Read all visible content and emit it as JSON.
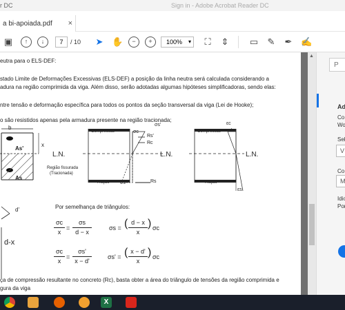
{
  "window": {
    "title_left": "r DC",
    "title_center": "Sign in - Adobe Acrobat Reader DC"
  },
  "tab": {
    "label": "a bi-apoiada.pdf"
  },
  "toolbar": {
    "page_current": "7",
    "page_total": "/ 10",
    "zoom": "100%"
  },
  "doc": {
    "line1": "eutra para o ELS-DEF:",
    "line2": "stado Limite de Deformações Excessivas (ELS-DEF) a posição da linha neutra será calculada considerando a",
    "line3": "adura na região comprimida da viga. Além disso, serão adotadas algumas hipóteses simplificadoras, sendo elas:",
    "line4": "ntre tensão e deformação específica para todos os pontos da seção transversal da viga (Lei de Hooke);",
    "line5": "o são resistidos apenas pela armadura presente na região tracionada;",
    "fig1": {
      "b": "b",
      "x": "x",
      "as_top": "As'",
      "as_bot": "As",
      "ln": "L.N.",
      "region": "Região fissurada",
      "region2": "(Tracionada)"
    },
    "fig2": {
      "comp": "Compressão",
      "trac": "Tração",
      "rs_prime": "Rs'",
      "rc": "Rc",
      "rs": "Rs",
      "ln": "L.N.",
      "sigma_s_prime": "σs'",
      "sigma_c": "σc",
      "sigma_s": "σs"
    },
    "fig3": {
      "comp": "Compressão",
      "trac": "Tração",
      "ln": "L.N.",
      "ec": "εc",
      "es_prime": "εs'",
      "es": "εs"
    },
    "tri_label": "Por semelhança de triângulos:",
    "dx": "d-x",
    "dprime": "d'",
    "eq1_left_num": "σc",
    "eq1_left_den": "x",
    "eq1_mid_num": "σs",
    "eq1_mid_den": "d − x",
    "eq1_right": "σs = ",
    "eq1_right_num": "d − x",
    "eq1_right_den": "x",
    "eq1_right_tail": "σc",
    "eq2_left_num": "σc",
    "eq2_left_den": "x",
    "eq2_mid_num": "σs'",
    "eq2_mid_den": "x − d'",
    "eq2_right": "σs' = ",
    "eq2_right_num": "x − d'",
    "eq2_right_den": "x",
    "eq2_right_tail": "σc",
    "line6": "ça de compressão resultante no concreto (Rc), basta obter a área do triângulo de tensões da região comprimida e",
    "line7": "gura da viga"
  },
  "right_panel": {
    "search_placeholder": "P",
    "heading": "Ad",
    "t1": "Co",
    "t2": "Wo",
    "sel_label": "Sele",
    "sel_value": "V",
    "t3": "Co",
    "sel2_value": "M",
    "t4": "Idio",
    "t5": "Por"
  },
  "taskbar": {
    "apps": [
      "chrome-icon",
      "media-player-icon",
      "firefox-icon",
      "settings-icon",
      "excel-icon",
      "acrobat-icon"
    ]
  },
  "colors": {
    "accent": "#1473e6",
    "taskbar": "#1a1f2b",
    "excel": "#1e7145",
    "acrobat": "#d9261c"
  }
}
